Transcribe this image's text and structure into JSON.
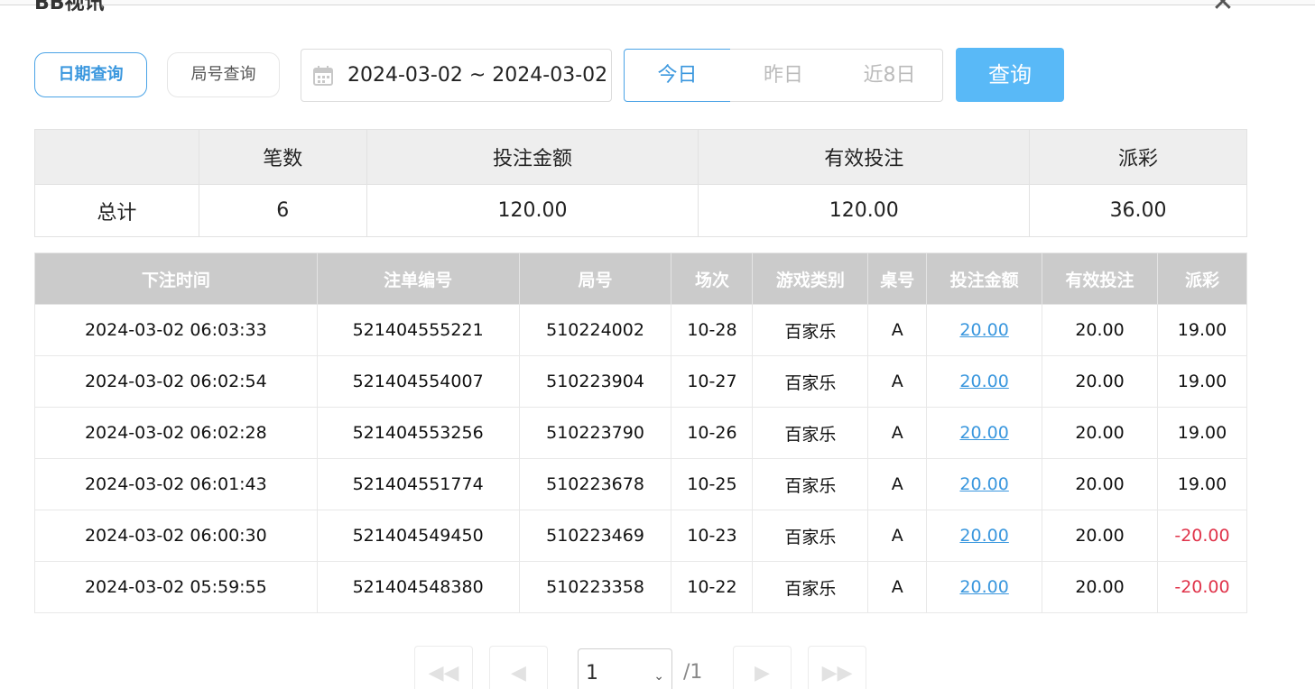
{
  "dialog": {
    "title": "BB视讯",
    "close_icon": "close-icon"
  },
  "modes": {
    "date": "日期查询",
    "round": "局号查询"
  },
  "date_range": {
    "value": "2024-03-02 ~ 2024-03-02",
    "icon": "calendar-icon"
  },
  "quick": {
    "today": "今日",
    "yesterday": "昨日",
    "last8": "近8日"
  },
  "query_label": "查询",
  "summary": {
    "headers": [
      "",
      "笔数",
      "投注金额",
      "有效投注",
      "派彩"
    ],
    "row": [
      "总计",
      "6",
      "120.00",
      "120.00",
      "36.00"
    ]
  },
  "detail": {
    "headers": [
      "下注时间",
      "注单编号",
      "局号",
      "场次",
      "游戏类别",
      "桌号",
      "投注金额",
      "有效投注",
      "派彩"
    ],
    "rows": [
      [
        "2024-03-02 06:03:33",
        "521404555221",
        "510224002",
        "10-28",
        "百家乐",
        "A",
        "20.00",
        "20.00",
        "19.00"
      ],
      [
        "2024-03-02 06:02:54",
        "521404554007",
        "510223904",
        "10-27",
        "百家乐",
        "A",
        "20.00",
        "20.00",
        "19.00"
      ],
      [
        "2024-03-02 06:02:28",
        "521404553256",
        "510223790",
        "10-26",
        "百家乐",
        "A",
        "20.00",
        "20.00",
        "19.00"
      ],
      [
        "2024-03-02 06:01:43",
        "521404551774",
        "510223678",
        "10-25",
        "百家乐",
        "A",
        "20.00",
        "20.00",
        "19.00"
      ],
      [
        "2024-03-02 06:00:30",
        "521404549450",
        "510223469",
        "10-23",
        "百家乐",
        "A",
        "20.00",
        "20.00",
        "-20.00"
      ],
      [
        "2024-03-02 05:59:55",
        "521404548380",
        "510223358",
        "10-22",
        "百家乐",
        "A",
        "20.00",
        "20.00",
        "-20.00"
      ]
    ]
  },
  "pager": {
    "current": "1",
    "total": "/1",
    "first": "◀◀",
    "prev": "◀",
    "next": "▶",
    "last": "▶▶"
  },
  "colors": {
    "accent": "#3a97de",
    "button": "#59b9f7",
    "negative": "#e0334a",
    "header_bg": "#cbcbcb"
  }
}
